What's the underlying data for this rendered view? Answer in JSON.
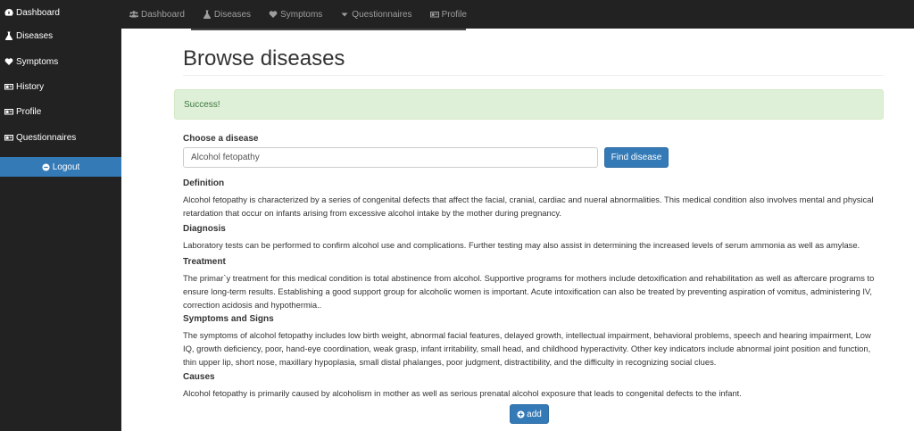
{
  "sidebar": {
    "items": [
      {
        "label": "Dashboard",
        "icon": "dashboard-icon"
      },
      {
        "label": "Diseases",
        "icon": "flask-icon"
      },
      {
        "label": "Symptoms",
        "icon": "heartbeat-icon"
      },
      {
        "label": "History",
        "icon": "id-card-icon"
      },
      {
        "label": "Profile",
        "icon": "id-card-icon"
      },
      {
        "label": "Questionnaires",
        "icon": "id-card-icon"
      }
    ],
    "logout_label": "Logout"
  },
  "topnav": {
    "items": [
      {
        "label": "Dashboard",
        "icon": "users-icon"
      },
      {
        "label": "Diseases",
        "icon": "flask-icon"
      },
      {
        "label": "Symptoms",
        "icon": "heartbeat-icon"
      },
      {
        "label": "Questionnaires",
        "icon": "caret-down-icon"
      },
      {
        "label": "Profile",
        "icon": "id-card-icon"
      }
    ]
  },
  "main": {
    "title": "Browse diseases",
    "alert": "Success!",
    "choose_label": "Choose a disease",
    "disease_value": "Alcohol fetopathy",
    "find_button": "Find disease",
    "sections": {
      "definition": {
        "heading": "Definition",
        "body": "Alcohol fetopathy is characterized by a series of congenital defects that affect the facial, cranial, cardiac and nueral abnormalities. This medical condition also involves mental and physical retardation that occur on infants arising from excessive alcohol intake by the mother during pregnancy."
      },
      "diagnosis": {
        "heading": "Diagnosis",
        "body": "Laboratory tests can be performed to confirm alcohol use and complications. Further testing may also assist in determining the increased levels of serum ammonia as well as amylase."
      },
      "treatment": {
        "heading": "Treatment",
        "body": "The primar`y treatment for this medical condition is total abstinence from alcohol. Supportive programs for mothers include detoxification and rehabilitation as well as aftercare programs to ensure long-term results. Establishing a good support group for alcoholic women is important. Acute intoxification can also be treated by preventing aspiration of vomitus, administering IV, correction acidosis and hypothermia.."
      },
      "symptoms": {
        "heading": "Symptoms and Signs",
        "body": "The symptoms of alcohol fetopathy includes low birth weight, abnormal facial features, delayed growth, intellectual impairment, behavioral problems, speech and hearing impairment, Low IQ, growth deficiency, poor, hand-eye coordination, weak grasp, infant irritability, small head, and childhood hyperactivity. Other key indicators include abnormal joint position and function, thin upper lip, short nose, maxillary hypoplasia, small distal phalanges, poor judgment, distractibility, and the difficulty in recognizing social clues."
      },
      "causes": {
        "heading": "Causes",
        "body": "Alcohol fetopathy is primarily caused by alcoholism in mother as well as serious prenatal alcohol exposure that leads to congenital defects to the infant."
      }
    },
    "add_button": "add"
  },
  "colors": {
    "sidebar_bg": "#222222",
    "primary": "#337ab7",
    "alert_bg": "#dff0d8",
    "alert_text": "#3c763d"
  }
}
